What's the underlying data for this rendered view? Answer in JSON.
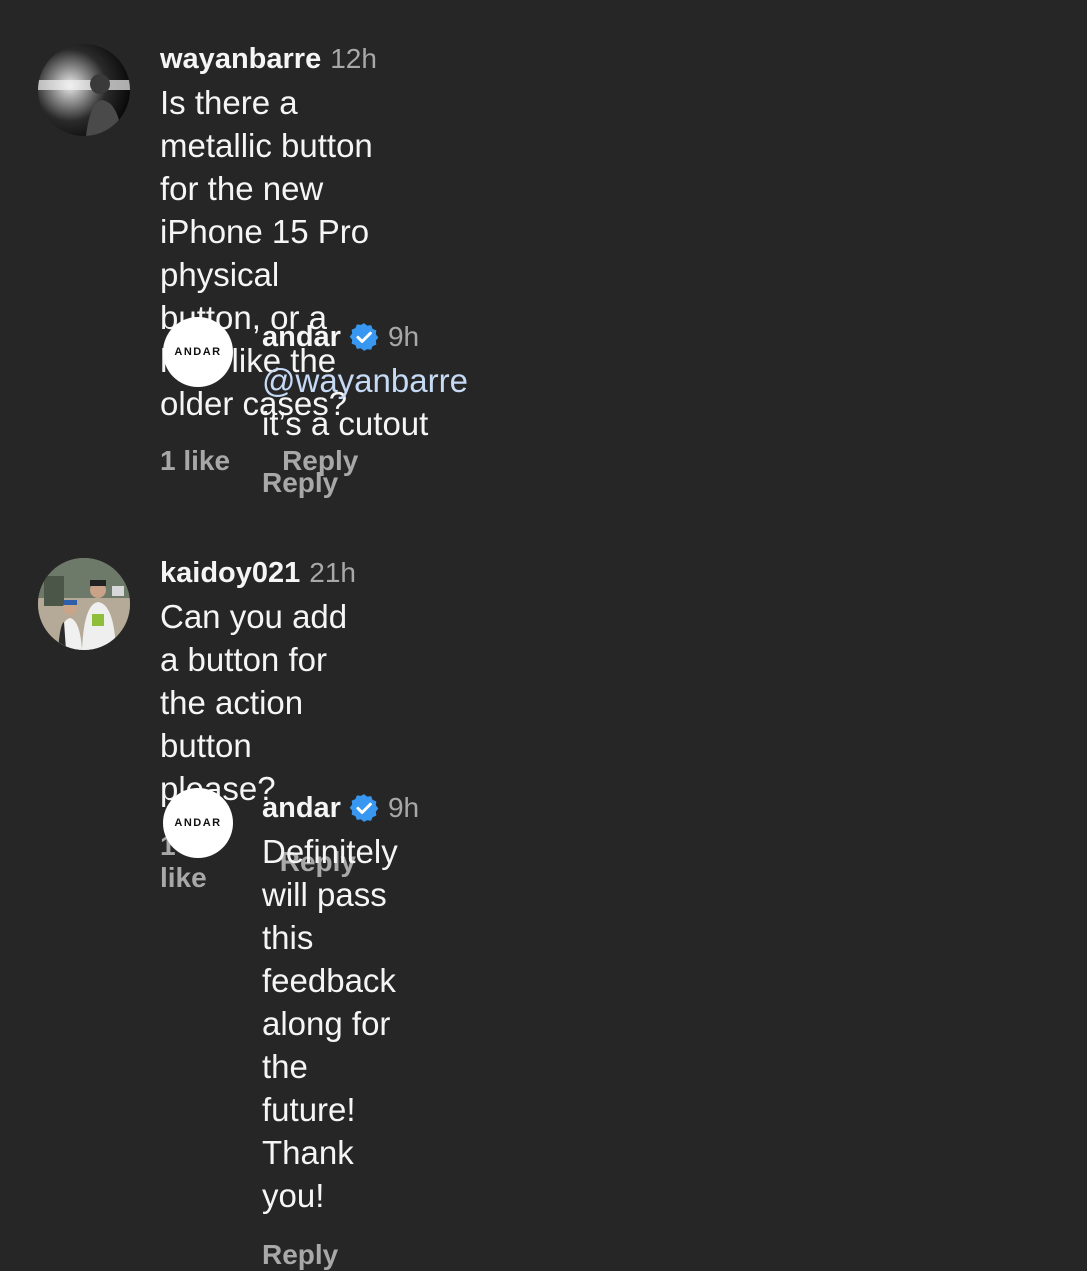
{
  "comments": [
    {
      "username": "wayanbarre",
      "time": "12h",
      "text": "Is there a metallic button for the new iPhone 15 Pro\nphysical button, or a hole like the older cases?",
      "likes": "1 like",
      "reply_label": "Reply"
    },
    {
      "username": "andar",
      "verified": true,
      "time": "9h",
      "mention": "@wayanbarre",
      "text": " it’s a cutout",
      "reply_label": "Reply",
      "avatar_text": "ANDAR"
    },
    {
      "username": "kaidoy021",
      "time": "21h",
      "text": "Can you add a button for the action button please?",
      "likes": "1 like",
      "reply_label": "Reply"
    },
    {
      "username": "andar",
      "verified": true,
      "time": "9h",
      "text": "Definitely will pass this feedback along for the\nfuture! Thank you!",
      "reply_label": "Reply",
      "avatar_text": "ANDAR"
    }
  ],
  "colors": {
    "background": "#262626",
    "text": "#f5f5f5",
    "muted": "#a8a8a8",
    "mention": "#c6daf6",
    "verified": "#3897f0"
  }
}
